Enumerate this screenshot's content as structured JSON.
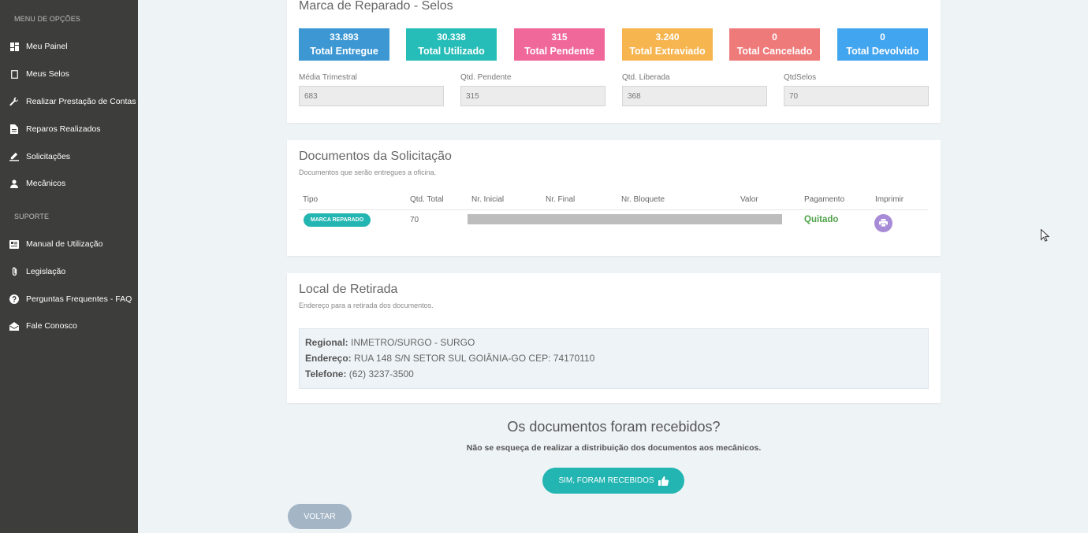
{
  "sidebar": {
    "section1": "MENU DE OPÇÕES",
    "section2": "SUPORTE",
    "items": [
      {
        "label": "Meu Painel"
      },
      {
        "label": "Meus Selos"
      },
      {
        "label": "Realizar Prestação de Contas"
      },
      {
        "label": "Reparos Realizados"
      },
      {
        "label": "Solicitações"
      },
      {
        "label": "Mecânicos"
      },
      {
        "label": "Manual de Utilização"
      },
      {
        "label": "Legislação"
      },
      {
        "label": "Perguntas Frequentes - FAQ"
      },
      {
        "label": "Fale Conosco"
      }
    ]
  },
  "selos": {
    "title": "Marca de Reparado - Selos",
    "stats": [
      {
        "value": "33.893",
        "label": "Total Entregue",
        "color": "#3c97d3"
      },
      {
        "value": "30.338",
        "label": "Total Utilizado",
        "color": "#26bdb8"
      },
      {
        "value": "315",
        "label": "Total Pendente",
        "color": "#f0679a"
      },
      {
        "value": "3.240",
        "label": "Total Extraviado",
        "color": "#f6b54f"
      },
      {
        "value": "0",
        "label": "Total Cancelado",
        "color": "#ef7a7a"
      },
      {
        "value": "0",
        "label": "Total Devolvido",
        "color": "#42a5f0"
      }
    ],
    "fields": [
      {
        "label": "Média Trimestral",
        "value": "683"
      },
      {
        "label": "Qtd. Pendente",
        "value": "315"
      },
      {
        "label": "Qtd. Liberada",
        "value": "368"
      },
      {
        "label": "QtdSelos",
        "value": "70"
      }
    ]
  },
  "documentos": {
    "title": "Documentos da Solicitação",
    "subtitle": "Documentos que serão entregues a oficina.",
    "columns": [
      "Tipo",
      "Qtd. Total",
      "Nr. Inicial",
      "Nr. Final",
      "Nr. Bloquete",
      "Valor",
      "Pagamento",
      "Imprimir"
    ],
    "row": {
      "tipo": "MARCA REPARADO",
      "qtd_total": "70",
      "pagamento": "Quitado"
    }
  },
  "local": {
    "title": "Local de Retirada",
    "subtitle": "Endereço para a retirada dos documentos.",
    "regional_label": "Regional:",
    "regional": "INMETRO/SURGO - SURGO",
    "endereco_label": "Endereço:",
    "endereco": "RUA 148 S/N SETOR SUL GOIÂNIA-GO CEP: 74170110",
    "telefone_label": "Telefone:",
    "telefone": "(62) 3237-3500"
  },
  "confirm": {
    "question": "Os documentos foram recebidos?",
    "note": "Não se esqueça de realizar a distribuição dos documentos aos mecânicos.",
    "button": "SIM, FORAM RECEBIDOS",
    "back": "VOLTAR"
  },
  "icons": {
    "sidebar": [
      "dashboard-icon",
      "square-icon",
      "wrench-icon",
      "document-icon",
      "pencil-icon",
      "user-icon",
      "book-icon",
      "paperclip-icon",
      "question-icon",
      "envelope-icon"
    ],
    "print": "printer-icon",
    "thumb": "thumbs-up-icon"
  }
}
